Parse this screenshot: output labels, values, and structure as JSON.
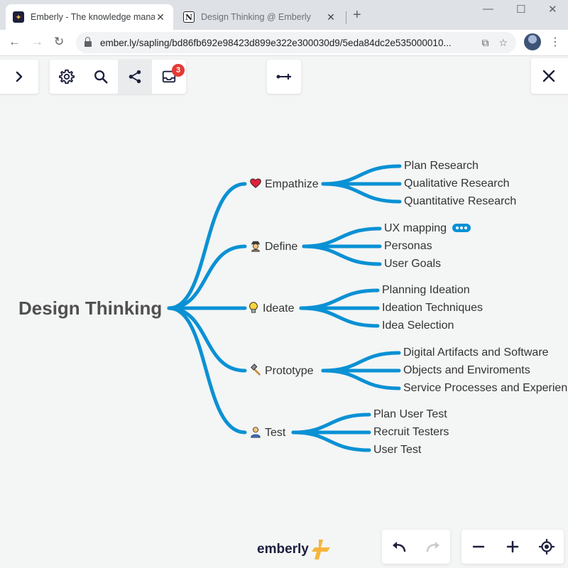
{
  "browser": {
    "tabs": [
      {
        "title": "Emberly - The knowledge manag",
        "icon": "emberly-favicon",
        "active": true
      },
      {
        "title": "Design Thinking @ Emberly",
        "icon": "notion-favicon",
        "active": false
      }
    ],
    "url": "ember.ly/sapling/bd86fb692e98423d899e322e300030d9/5eda84dc2e535000010..."
  },
  "toolbar": {
    "notifications_count": "3"
  },
  "mindmap": {
    "root": "Design Thinking",
    "branches": [
      {
        "label": "Empathize",
        "icon": "heart-icon",
        "children": [
          "Plan Research",
          "Qualitative Research",
          "Quantitative Research"
        ]
      },
      {
        "label": "Define",
        "icon": "detective-icon",
        "children": [
          "UX mapping",
          "Personas",
          "User Goals"
        ]
      },
      {
        "label": "Ideate",
        "icon": "lightbulb-icon",
        "children": [
          "Planning Ideation",
          "Ideation Techniques",
          "Idea Selection"
        ]
      },
      {
        "label": "Prototype",
        "icon": "hammer-icon",
        "children": [
          "Digital Artifacts and Software",
          "Objects and Enviroments",
          "Service Processes and Experien"
        ]
      },
      {
        "label": "Test",
        "icon": "user-icon",
        "children": [
          "Plan User Test",
          "Recruit Testers",
          "User Test"
        ]
      }
    ],
    "line_color": "#0a91d4"
  },
  "brand": {
    "name": "emberly"
  },
  "colors": {
    "accent": "#0a91d4",
    "badge": "#e53935",
    "dark": "#1d1f3d",
    "logo_orange": "#f6b53c"
  }
}
